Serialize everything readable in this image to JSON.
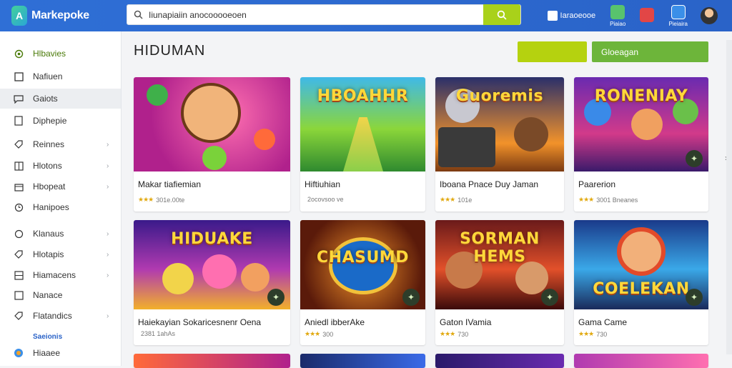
{
  "app": {
    "logo_text": "Markepoke",
    "logo_letter": "A"
  },
  "search": {
    "value": "Iiunapiaiin anocooooeoen",
    "placeholder": ""
  },
  "top_right": {
    "inline_label": "Iaraoeooe",
    "item1": "Piaiao",
    "item2": "Pieiaira"
  },
  "sidebar": {
    "items": [
      {
        "label": "Hlbavies",
        "icon": "circle-icon"
      },
      {
        "label": "Nafiuen",
        "icon": "square-icon"
      },
      {
        "label": "Gaiots",
        "icon": "chat-icon"
      },
      {
        "label": "Diphepie",
        "icon": "doc-icon"
      },
      {
        "label": "Reinnes",
        "icon": "tag-icon"
      },
      {
        "label": "Hlotons",
        "icon": "grid-icon"
      },
      {
        "label": "Hbopeat",
        "icon": "box-icon"
      },
      {
        "label": "Hanipoes",
        "icon": "clock-icon"
      },
      {
        "label": "Klanaus",
        "icon": "circle-icon"
      },
      {
        "label": "Hlotapis",
        "icon": "tag-icon"
      },
      {
        "label": "Hiamacens",
        "icon": "grid-icon"
      },
      {
        "label": "Nanace",
        "icon": "square-icon"
      },
      {
        "label": "Flatandics",
        "icon": "tag-icon"
      },
      {
        "label": "Hiaaee",
        "icon": "globe-icon"
      }
    ],
    "section_label": "Saeionis"
  },
  "main": {
    "title": "HIDUMAN",
    "button_b": "Gloeagan"
  },
  "cards": [
    {
      "name": "Makar tiafiemian",
      "meta": "301e.00te",
      "stars": "★★★",
      "art_title": ""
    },
    {
      "name": "Hiftiuhian",
      "meta": "2ocovsoo ve",
      "stars": "",
      "art_title": "HBOAHHR"
    },
    {
      "name": "Iboana Pnace Duy Jaman",
      "meta": "101e",
      "stars": "★★★",
      "art_title": "Guoremis"
    },
    {
      "name": "Paarerion",
      "meta": "3001 Bneanes",
      "stars": "★★★",
      "art_title": "RONENIAY"
    },
    {
      "name": "Haiekayian Sokaricesnenr Oena",
      "meta": "2381 1ahAs",
      "stars": "",
      "art_title": "HIDUAKE"
    },
    {
      "name": "Aniedl ibberAke",
      "meta": "300",
      "stars": "★★★",
      "art_title": "CHASUMD"
    },
    {
      "name": "Gaton IVamia",
      "meta": "730",
      "stars": "★★★",
      "art_title": "SORMAN HEMS"
    },
    {
      "name": "Gama Came",
      "meta": "730",
      "stars": "★★★",
      "art_title": "COELEKAN"
    }
  ]
}
